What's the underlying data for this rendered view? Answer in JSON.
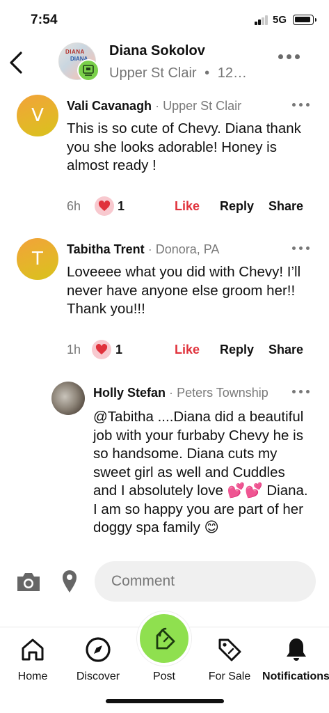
{
  "status_bar": {
    "time": "7:54",
    "network": "5G"
  },
  "header": {
    "name": "Diana Sokolov",
    "location": "Upper St Clair",
    "separator": "•",
    "time_partial": "12…",
    "avatar_text_1": "DIANA",
    "avatar_text_2": "DIANA"
  },
  "comments": [
    {
      "author": "Vali Cavanagh",
      "separator": "·",
      "location": "Upper St Clair",
      "initial": "V",
      "body": "This is so cute of Chevy. Diana thank you she looks adorable! Honey is almost ready !",
      "time": "6h",
      "reaction_count": "1",
      "actions": {
        "like": "Like",
        "reply": "Reply",
        "share": "Share"
      }
    },
    {
      "author": "Tabitha Trent",
      "separator": "·",
      "location": "Donora, PA",
      "initial": "T",
      "body": "Loveeee what you did with Chevy! I’ll never have anyone else groom her!! Thank you!!!",
      "time": "1h",
      "reaction_count": "1",
      "actions": {
        "like": "Like",
        "reply": "Reply",
        "share": "Share"
      }
    },
    {
      "author": "Holly Stefan",
      "separator": "·",
      "location": "Peters Township",
      "body": "@Tabitha ....Diana did a beautiful job with your furbaby Chevy he is so handsome. Diana cuts my sweet girl as well and Cuddles and I absolutely love 💕💕 Diana.  I am so happy you are part of her doggy spa family 😊"
    }
  ],
  "composer": {
    "placeholder": "Comment"
  },
  "nav": [
    {
      "label": "Home"
    },
    {
      "label": "Discover"
    },
    {
      "label": "Post"
    },
    {
      "label": "For Sale"
    },
    {
      "label": "Notifications"
    }
  ],
  "colors": {
    "like": "#e0323c",
    "post_green": "#8fe04f",
    "avatar_gradient": "#e5b52a"
  }
}
